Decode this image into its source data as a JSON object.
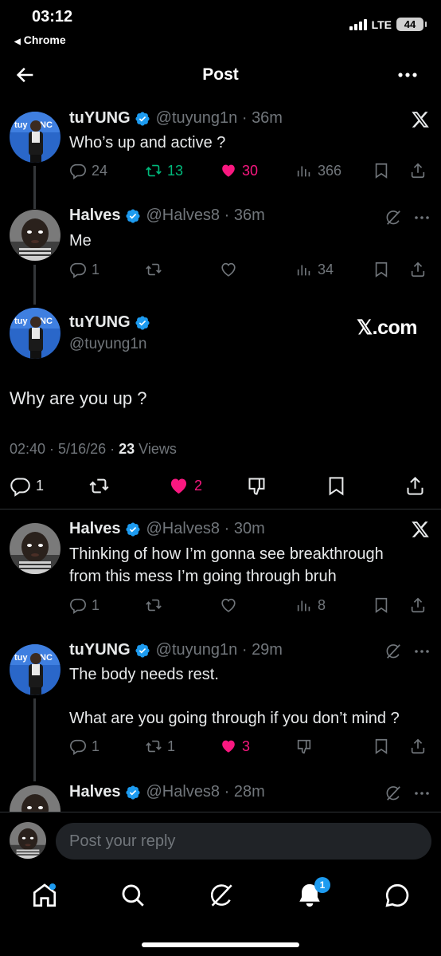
{
  "status": {
    "time": "03:12",
    "back_app": "Chrome",
    "network": "LTE",
    "battery": "44"
  },
  "nav": {
    "title": "Post"
  },
  "tweets": [
    {
      "name": "tuYUNG",
      "handle": "@tuyung1n",
      "time": "36m",
      "text": "Who’s up and active ?",
      "replies": "24",
      "reposts": "13",
      "likes": "30",
      "views": "366"
    },
    {
      "name": "Halves",
      "handle": "@Halves8",
      "time": "36m",
      "text": "Me",
      "replies": "1",
      "views": "34"
    }
  ],
  "main": {
    "name": "tuYUNG",
    "handle": "@tuyung1n",
    "brand": "𝕏.com",
    "text": "Why are you up ?",
    "time": "02:40",
    "date": "5/16/26",
    "views_count": "23",
    "views_label": "Views",
    "replies": "1",
    "likes": "2"
  },
  "replies": [
    {
      "name": "Halves",
      "handle": "@Halves8",
      "time": "30m",
      "text1": "Thinking of how I’m gonna see breakthrough",
      "text2": "from this mess I’m going through bruh",
      "replies": "1",
      "views": "8"
    },
    {
      "name": "tuYUNG",
      "handle": "@tuyung1n",
      "time": "29m",
      "text1": "The body needs rest.",
      "text2": "What are you going through if you don’t mind ?",
      "replies": "1",
      "reposts": "1",
      "likes": "3"
    },
    {
      "name": "Halves",
      "handle": "@Halves8",
      "time": "28m"
    }
  ],
  "reply_bar": {
    "placeholder": "Post your reply"
  },
  "tabbar": {
    "notification_count": "1"
  },
  "icons": [
    "back-arrow-icon",
    "more-icon",
    "x-logo-icon",
    "grok-icon",
    "reply-icon",
    "repost-icon",
    "like-icon",
    "views-icon",
    "bookmark-icon",
    "share-icon",
    "dislike-icon",
    "home-icon",
    "search-icon",
    "notifications-icon",
    "messages-icon"
  ],
  "colors": {
    "background": "#000000",
    "text": "#e7e9ea",
    "muted": "#71767b",
    "like": "#f91880",
    "repost": "#00ba7c",
    "verified": "#1d9bf0"
  }
}
